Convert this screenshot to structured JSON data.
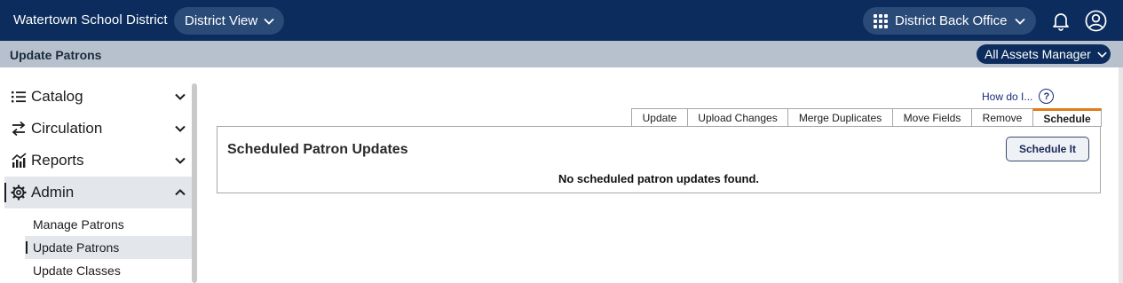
{
  "header": {
    "district_name": "Watertown School District",
    "view_selector": "District View",
    "office_selector": "District Back Office"
  },
  "subheader": {
    "page_title": "Update Patrons",
    "role_selector": "All Assets Manager"
  },
  "sidebar": {
    "items": [
      {
        "label": "Catalog",
        "icon": "list-icon",
        "expanded": false
      },
      {
        "label": "Circulation",
        "icon": "swap-arrows-icon",
        "expanded": false
      },
      {
        "label": "Reports",
        "icon": "chart-icon",
        "expanded": false
      },
      {
        "label": "Admin",
        "icon": "gear-icon",
        "expanded": true
      }
    ],
    "subitems": [
      {
        "label": "Manage Patrons",
        "active": false
      },
      {
        "label": "Update Patrons",
        "active": true
      },
      {
        "label": "Update Classes",
        "active": false
      }
    ]
  },
  "main": {
    "help_link": "How do I...",
    "help_icon_text": "?",
    "tabs": [
      {
        "label": "Update"
      },
      {
        "label": "Upload Changes"
      },
      {
        "label": "Merge Duplicates"
      },
      {
        "label": "Move Fields"
      },
      {
        "label": "Remove"
      },
      {
        "label": "Schedule",
        "active": true
      }
    ],
    "panel_title": "Scheduled Patron Updates",
    "schedule_button": "Schedule It",
    "empty_message": "No scheduled patron updates found."
  },
  "colors": {
    "topbar": "#0b2c5c",
    "pill": "#2a4a78",
    "subbar": "#b7c1cd",
    "active_tab_accent": "#e07b1a"
  }
}
